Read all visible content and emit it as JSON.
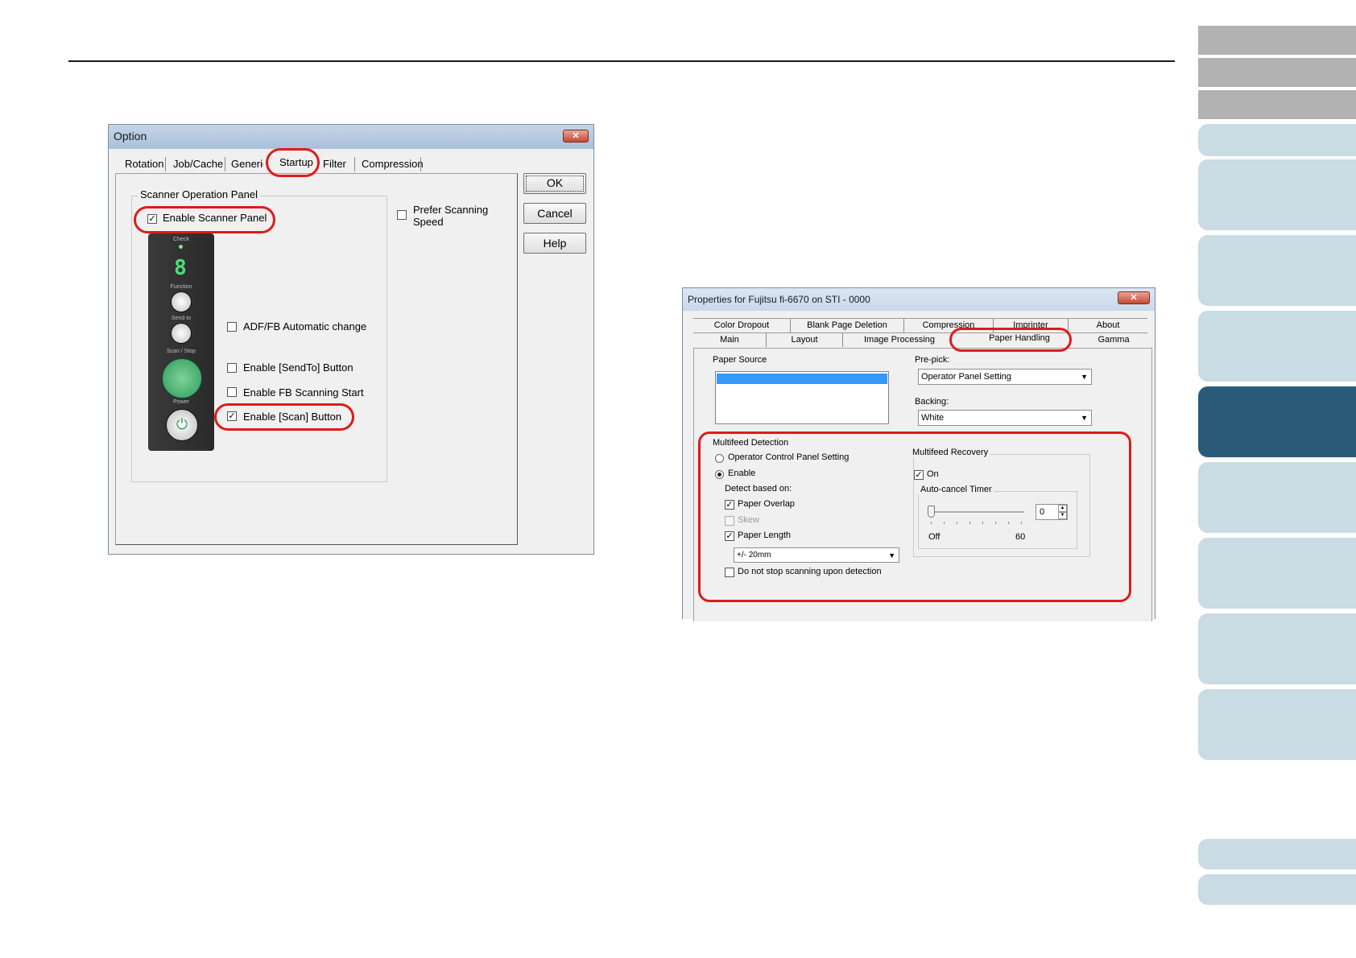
{
  "option_dialog": {
    "title": "Option",
    "tabs": [
      "Rotation",
      "Job/Cache",
      "Generic",
      "Startup",
      "Filter",
      "Compression"
    ],
    "active_tab": "Startup",
    "group_title": "Scanner Operation Panel",
    "enable_scanner_panel": "Enable Scanner Panel",
    "prefer_scanning_speed_line1": "Prefer Scanning",
    "prefer_scanning_speed_line2": "Speed",
    "adf_fb_auto": "ADF/FB Automatic change",
    "enable_sendto": "Enable [SendTo] Button",
    "enable_fb_start": "Enable FB Scanning Start",
    "enable_scan": "Enable [Scan] Button",
    "ok": "OK",
    "cancel": "Cancel",
    "help": "Help",
    "panel": {
      "check": "Check",
      "digit": "8",
      "function": "Function",
      "send_to": "Send to",
      "scan_stop": "Scan / Stop",
      "power": "Power"
    }
  },
  "props_dialog": {
    "title": "Properties for Fujitsu fi-6670 on STI - 0000",
    "tabs_row1": [
      "Color Dropout",
      "Blank Page Deletion",
      "Compression",
      "Imprinter",
      "About"
    ],
    "tabs_row2": [
      "Main",
      "Layout",
      "Image Processing",
      "Paper Handling",
      "Gamma"
    ],
    "active_tab": "Paper Handling",
    "paper_source": "Paper Source",
    "pre_pick": "Pre-pick:",
    "pre_pick_value": "Operator Panel Setting",
    "backing": "Backing:",
    "backing_value": "White",
    "multifeed_detection": "Multifeed Detection",
    "operator_control_panel_setting": "Operator Control Panel Setting",
    "enable": "Enable",
    "detect_based_on": "Detect based on:",
    "paper_overlap": "Paper Overlap",
    "skew": "Skew",
    "paper_length": "Paper Length",
    "length_value": "+/- 20mm",
    "do_not_stop": "Do not stop scanning upon detection",
    "multifeed_recovery": "Multifeed Recovery",
    "on": "On",
    "auto_cancel_timer": "Auto-cancel Timer",
    "timer_value": "0",
    "slider_min": "Off",
    "slider_max": "60"
  }
}
